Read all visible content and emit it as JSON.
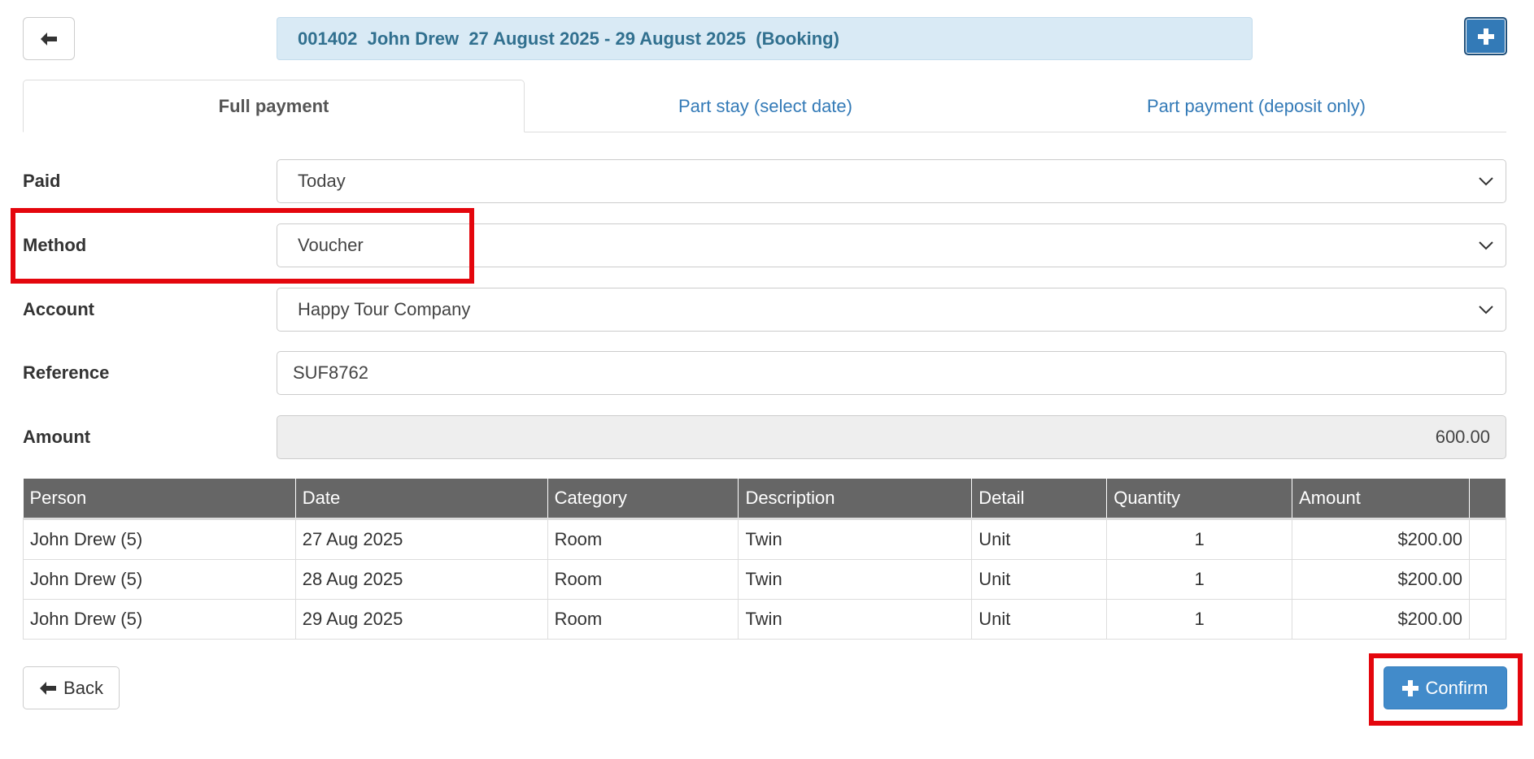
{
  "header": {
    "booking_banner": "001402  John Drew  27 August 2025 - 29 August 2025  (Booking)",
    "back_icon": "arrow-left-icon",
    "add_icon": "plus-icon"
  },
  "tabs": [
    {
      "label": "Full payment",
      "active": true
    },
    {
      "label": "Part stay (select date)",
      "active": false
    },
    {
      "label": "Part payment (deposit only)",
      "active": false
    }
  ],
  "form": {
    "paid": {
      "label": "Paid",
      "value": "Today"
    },
    "method": {
      "label": "Method",
      "value": "Voucher"
    },
    "account": {
      "label": "Account",
      "value": "Happy Tour Company"
    },
    "reference": {
      "label": "Reference",
      "value": "SUF8762"
    },
    "amount": {
      "label": "Amount",
      "value": "600.00"
    }
  },
  "table": {
    "columns": [
      "Person",
      "Date",
      "Category",
      "Description",
      "Detail",
      "Quantity",
      "Amount",
      ""
    ],
    "rows": [
      [
        "John Drew (5)",
        "27 Aug 2025",
        "Room",
        "Twin",
        "Unit",
        "1",
        "$200.00",
        ""
      ],
      [
        "John Drew (5)",
        "28 Aug 2025",
        "Room",
        "Twin",
        "Unit",
        "1",
        "$200.00",
        ""
      ],
      [
        "John Drew (5)",
        "29 Aug 2025",
        "Room",
        "Twin",
        "Unit",
        "1",
        "$200.00",
        ""
      ]
    ]
  },
  "buttons": {
    "back_label": "Back",
    "confirm_label": "Confirm"
  },
  "colors": {
    "primary": "#428bca",
    "banner_bg": "#d9eaf5",
    "banner_text": "#31708f",
    "header_bg": "#666666",
    "highlight": "#e4060d"
  }
}
